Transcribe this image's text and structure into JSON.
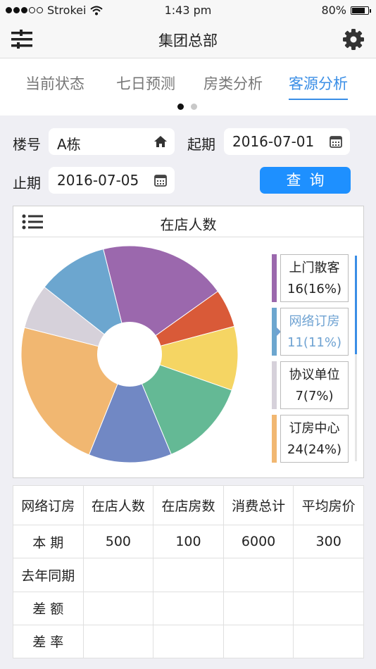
{
  "status_bar": {
    "carrier": "Strokei",
    "time": "1:43 pm",
    "battery": "80%",
    "battery_level": 0.8
  },
  "header": {
    "title": "集团总部",
    "menu_icon": "menu-icon",
    "settings_icon": "gear-icon"
  },
  "tabs": [
    {
      "label": "当前状态",
      "active": false
    },
    {
      "label": "七日预测",
      "active": false
    },
    {
      "label": "房类分析",
      "active": false
    },
    {
      "label": "客源分析",
      "active": true
    }
  ],
  "pager": {
    "pages": 2,
    "current": 1
  },
  "filters": {
    "building_label": "楼号",
    "building_value": "A栋",
    "building_icon": "home-icon",
    "start_label": "起期",
    "start_value": "2016-07-01",
    "end_label": "止期",
    "end_value": "2016-07-05",
    "date_icon": "calendar-icon",
    "query_button": "查询"
  },
  "chart_card": {
    "title": "在店人数",
    "icon": "list-icon"
  },
  "chart_data": {
    "type": "pie",
    "title": "在店人数",
    "donut": true,
    "slices": [
      {
        "name": "",
        "value": 20,
        "color": "#9b68ad"
      },
      {
        "name": "",
        "value": 6,
        "color": "#d95a38"
      },
      {
        "name": "",
        "value": 10,
        "color": "#f5d563"
      },
      {
        "name": "",
        "value": 14,
        "color": "#64b995"
      },
      {
        "name": "",
        "value": 13,
        "color": "#7188c4"
      },
      {
        "name": "订房中心",
        "value": 24,
        "color": "#f1b771"
      },
      {
        "name": "协议单位",
        "value": 7,
        "color": "#d6d1da"
      },
      {
        "name": "网络订房",
        "value": 11,
        "color": "#6ca6cf"
      }
    ]
  },
  "legend": [
    {
      "name": "上门散客",
      "value": "16(16%)",
      "color": "#9b68ad",
      "selected": false
    },
    {
      "name": "网络订房",
      "value": "11(11%)",
      "color": "#6ca6cf",
      "selected": true
    },
    {
      "name": "协议单位",
      "value": "7(7%)",
      "color": "#d6d1da",
      "selected": false
    },
    {
      "name": "订房中心",
      "value": "24(24%)",
      "color": "#f1b771",
      "selected": false
    }
  ],
  "table": {
    "headers": [
      "网络订房",
      "在店人数",
      "在店房数",
      "消费总计",
      "平均房价"
    ],
    "rows": [
      [
        "本 期",
        "500",
        "100",
        "6000",
        "300"
      ],
      [
        "去年同期",
        "",
        "",
        "",
        ""
      ],
      [
        "差 额",
        "",
        "",
        "",
        ""
      ],
      [
        "差 率",
        "",
        "",
        "",
        ""
      ]
    ]
  }
}
